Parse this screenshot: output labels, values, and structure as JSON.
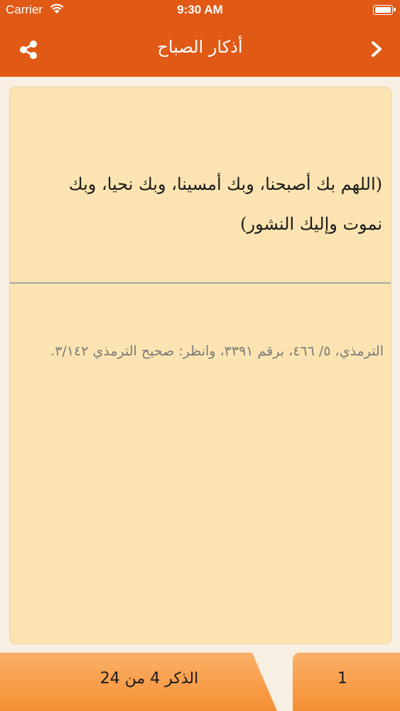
{
  "status_bar": {
    "carrier": "Carrier",
    "time": "9:30 AM",
    "icons": [
      "wifi-icon",
      "battery-icon"
    ]
  },
  "navbar": {
    "title": "أذكار الصباح",
    "icons": [
      "share-icon",
      "chevron-right-icon"
    ]
  },
  "card": {
    "zikr_text": "(اللهم بك أصبحنا، وبك أمسينا، وبك نحيا، وبك نموت وإليك النشور)",
    "source_text": "الترمذي، ٥/ ٤٦٦، برقم ٣٣٩١، وانظر: صحيح الترمذي ٣/١٤٢."
  },
  "bottom_bar": {
    "counter_label": "الذكر 4 من 24",
    "tap_count": "1"
  },
  "colors": {
    "header": "#e05a16",
    "card": "#fbe4b1",
    "bottom_bar": "#f8a050",
    "source_text": "#7a7a7a"
  }
}
